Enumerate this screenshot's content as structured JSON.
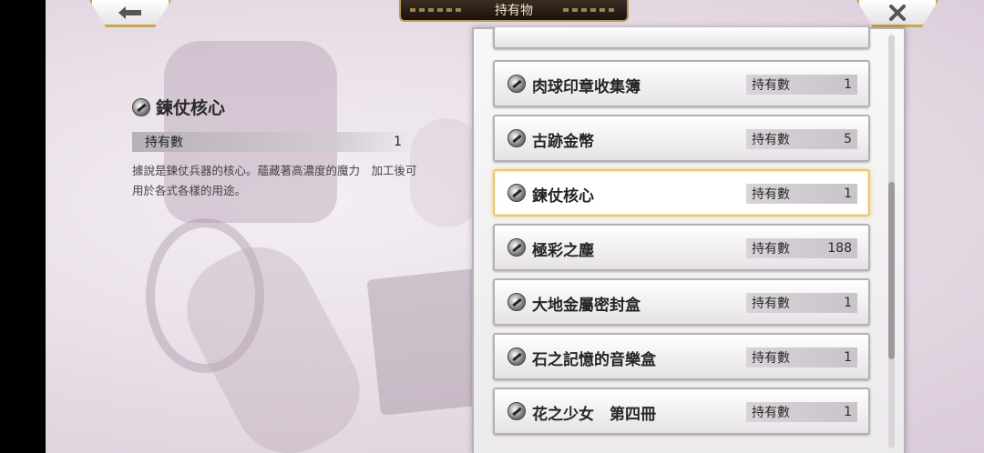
{
  "header": {
    "title": "持有物",
    "back_icon": "left-arrow-icon",
    "close_icon": "close-icon"
  },
  "detail": {
    "name": "鍊仗核心",
    "count_label": "持有數",
    "count_value": "1",
    "description": "據說是鍊仗兵器的核心。蘊藏著高濃度的魔力　加工後可用於各式各樣的用途。"
  },
  "list": {
    "count_label": "持有數",
    "items": [
      {
        "name": "肉球印章收集簿",
        "count": "1"
      },
      {
        "name": "古跡金幣",
        "count": "5"
      },
      {
        "name": "鍊仗核心",
        "count": "1"
      },
      {
        "name": "極彩之塵",
        "count": "188"
      },
      {
        "name": "大地金屬密封盒",
        "count": "1"
      },
      {
        "name": "石之記憶的音樂盒",
        "count": "1"
      },
      {
        "name": "花之少女　第四冊",
        "count": "1"
      }
    ],
    "selected": "鍊仗核心"
  }
}
